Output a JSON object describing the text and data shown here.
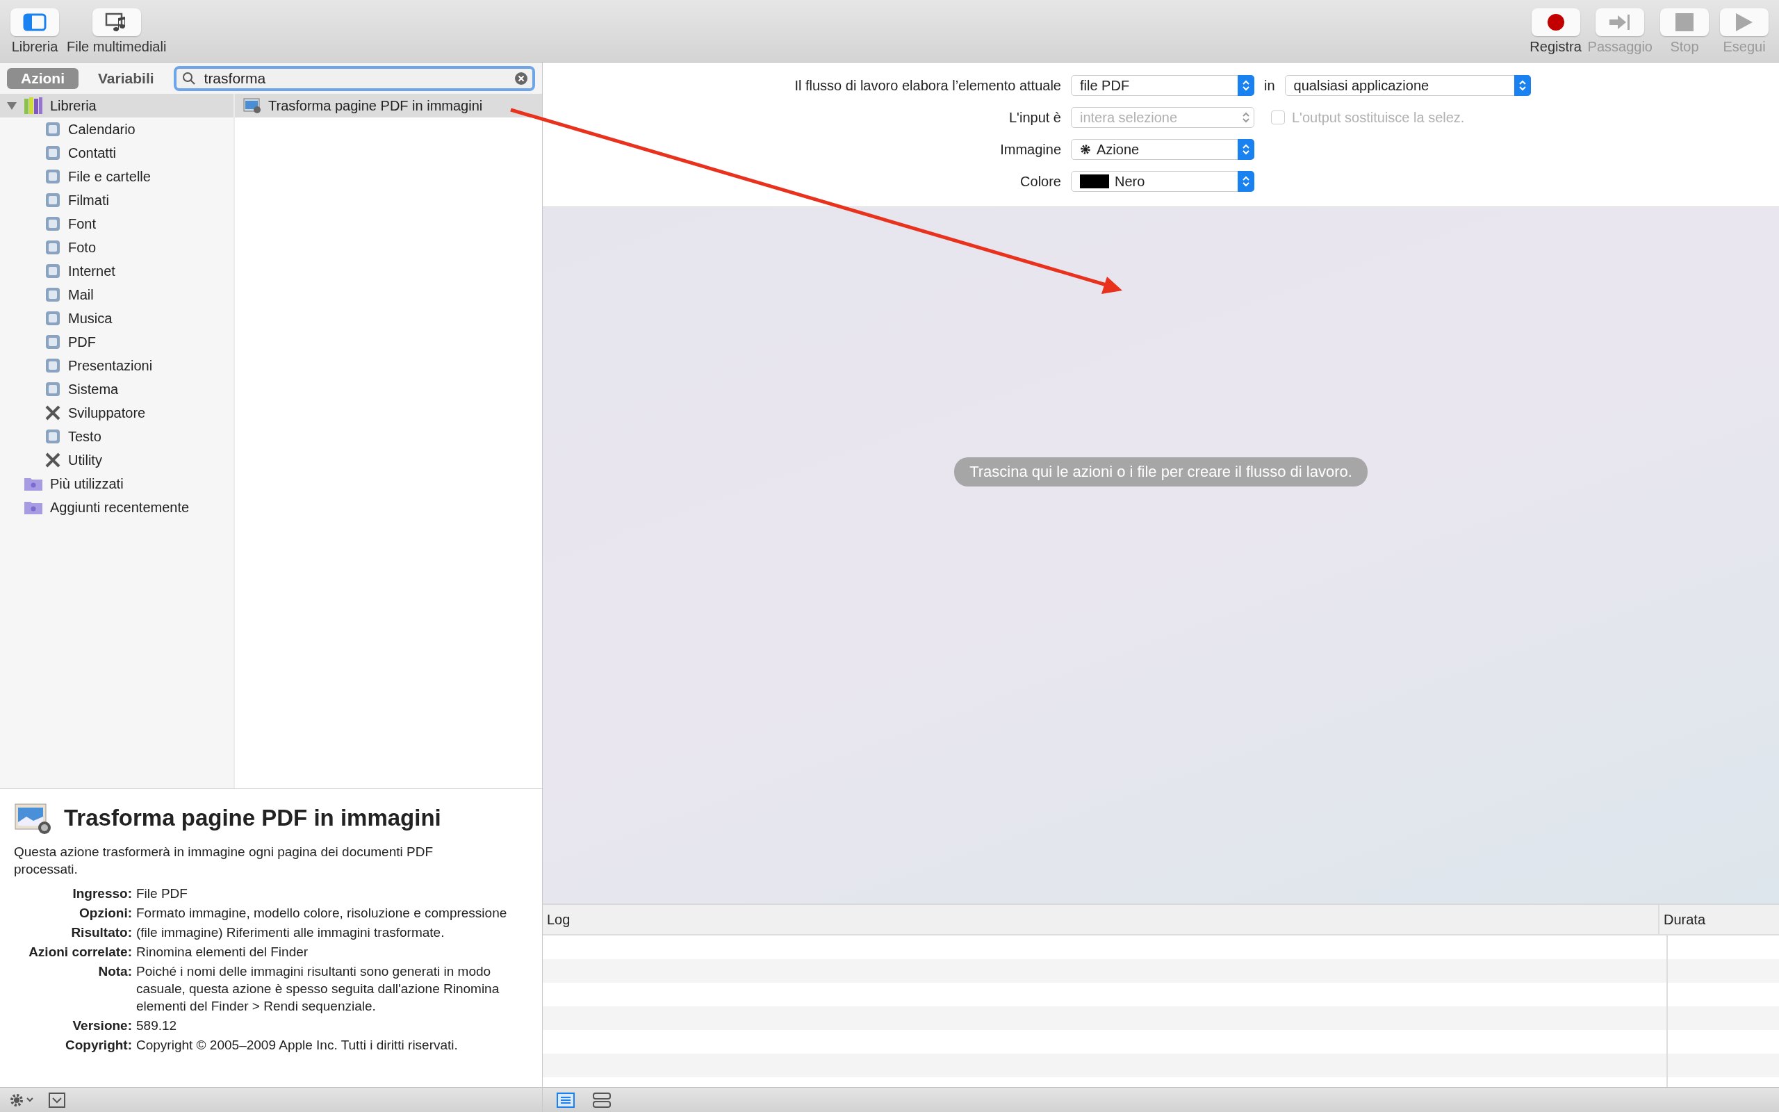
{
  "toolbar": {
    "left": [
      {
        "label": "Libreria",
        "kind": "library",
        "active": true,
        "disabled": false
      },
      {
        "label": "File multimediali",
        "kind": "media",
        "active": false,
        "disabled": false
      }
    ],
    "right": [
      {
        "label": "Registra",
        "kind": "record",
        "disabled": false
      },
      {
        "label": "Passaggio",
        "kind": "step",
        "disabled": true
      },
      {
        "label": "Stop",
        "kind": "stop",
        "disabled": true
      },
      {
        "label": "Esegui",
        "kind": "run",
        "disabled": true
      }
    ]
  },
  "tabs": [
    {
      "label": "Azioni",
      "selected": true
    },
    {
      "label": "Variabili",
      "selected": false
    }
  ],
  "search": {
    "value": "trasforma"
  },
  "library": [
    {
      "label": "Libreria",
      "kind": "library",
      "expanded": true,
      "selected": true,
      "children": [
        {
          "label": "Calendario",
          "kind": "category"
        },
        {
          "label": "Contatti",
          "kind": "category"
        },
        {
          "label": "File e cartelle",
          "kind": "category"
        },
        {
          "label": "Filmati",
          "kind": "category"
        },
        {
          "label": "Font",
          "kind": "category"
        },
        {
          "label": "Foto",
          "kind": "category"
        },
        {
          "label": "Internet",
          "kind": "category"
        },
        {
          "label": "Mail",
          "kind": "category"
        },
        {
          "label": "Musica",
          "kind": "category"
        },
        {
          "label": "PDF",
          "kind": "category"
        },
        {
          "label": "Presentazioni",
          "kind": "category"
        },
        {
          "label": "Sistema",
          "kind": "category"
        },
        {
          "label": "Sviluppatore",
          "kind": "tools"
        },
        {
          "label": "Testo",
          "kind": "category"
        },
        {
          "label": "Utility",
          "kind": "tools"
        }
      ]
    },
    {
      "label": "Più utilizzati",
      "kind": "folder",
      "selected": false
    },
    {
      "label": "Aggiunti recentemente",
      "kind": "folder",
      "selected": false
    }
  ],
  "actions": [
    {
      "label": "Trasforma pagine PDF in immagini",
      "selected": true
    }
  ],
  "description": {
    "title": "Trasforma pagine PDF in immagini",
    "text": "Questa azione trasformerà in immagine ogni pagina dei documenti PDF processati.",
    "fields": [
      {
        "label": "Ingresso:",
        "value": "File PDF"
      },
      {
        "label": "Opzioni:",
        "value": "Formato immagine, modello colore, risoluzione e compressione"
      },
      {
        "label": "Risultato:",
        "value": "(file immagine) Riferimenti alle immagini trasformate."
      },
      {
        "label": "Azioni correlate:",
        "value": "Rinomina elementi del Finder"
      },
      {
        "label": "Nota:",
        "value": "Poiché i nomi delle immagini risultanti sono generati in modo casuale, questa azione è spesso seguita dall'azione Rinomina elementi del Finder > Rendi sequenziale."
      },
      {
        "label": "Versione:",
        "value": "589.12"
      },
      {
        "label": "Copyright:",
        "value": "Copyright © 2005–2009 Apple Inc. Tutti i diritti riservati."
      }
    ]
  },
  "workflow": {
    "rows": [
      {
        "label": "Il flusso di lavoro elabora l’elemento attuale",
        "popup": {
          "value": "file PDF",
          "kind": "plain",
          "disabled": false
        },
        "joiner": "in",
        "popup2": {
          "value": "qualsiasi applicazione",
          "disabled": false
        }
      },
      {
        "label": "L'input è",
        "popup": {
          "value": "intera selezione",
          "kind": "plain",
          "disabled": true
        },
        "checkbox": {
          "label": "L'output sostituisce la selez.",
          "checked": false,
          "disabled": true
        }
      },
      {
        "label": "Immagine",
        "popup": {
          "value": "Azione",
          "kind": "gear",
          "disabled": false
        }
      },
      {
        "label": "Colore",
        "popup": {
          "value": "Nero",
          "kind": "swatch",
          "disabled": false
        }
      }
    ],
    "hint": "Trascina qui le azioni o i file per creare il flusso di lavoro."
  },
  "log": {
    "columns": [
      "Log",
      "Durata"
    ]
  }
}
